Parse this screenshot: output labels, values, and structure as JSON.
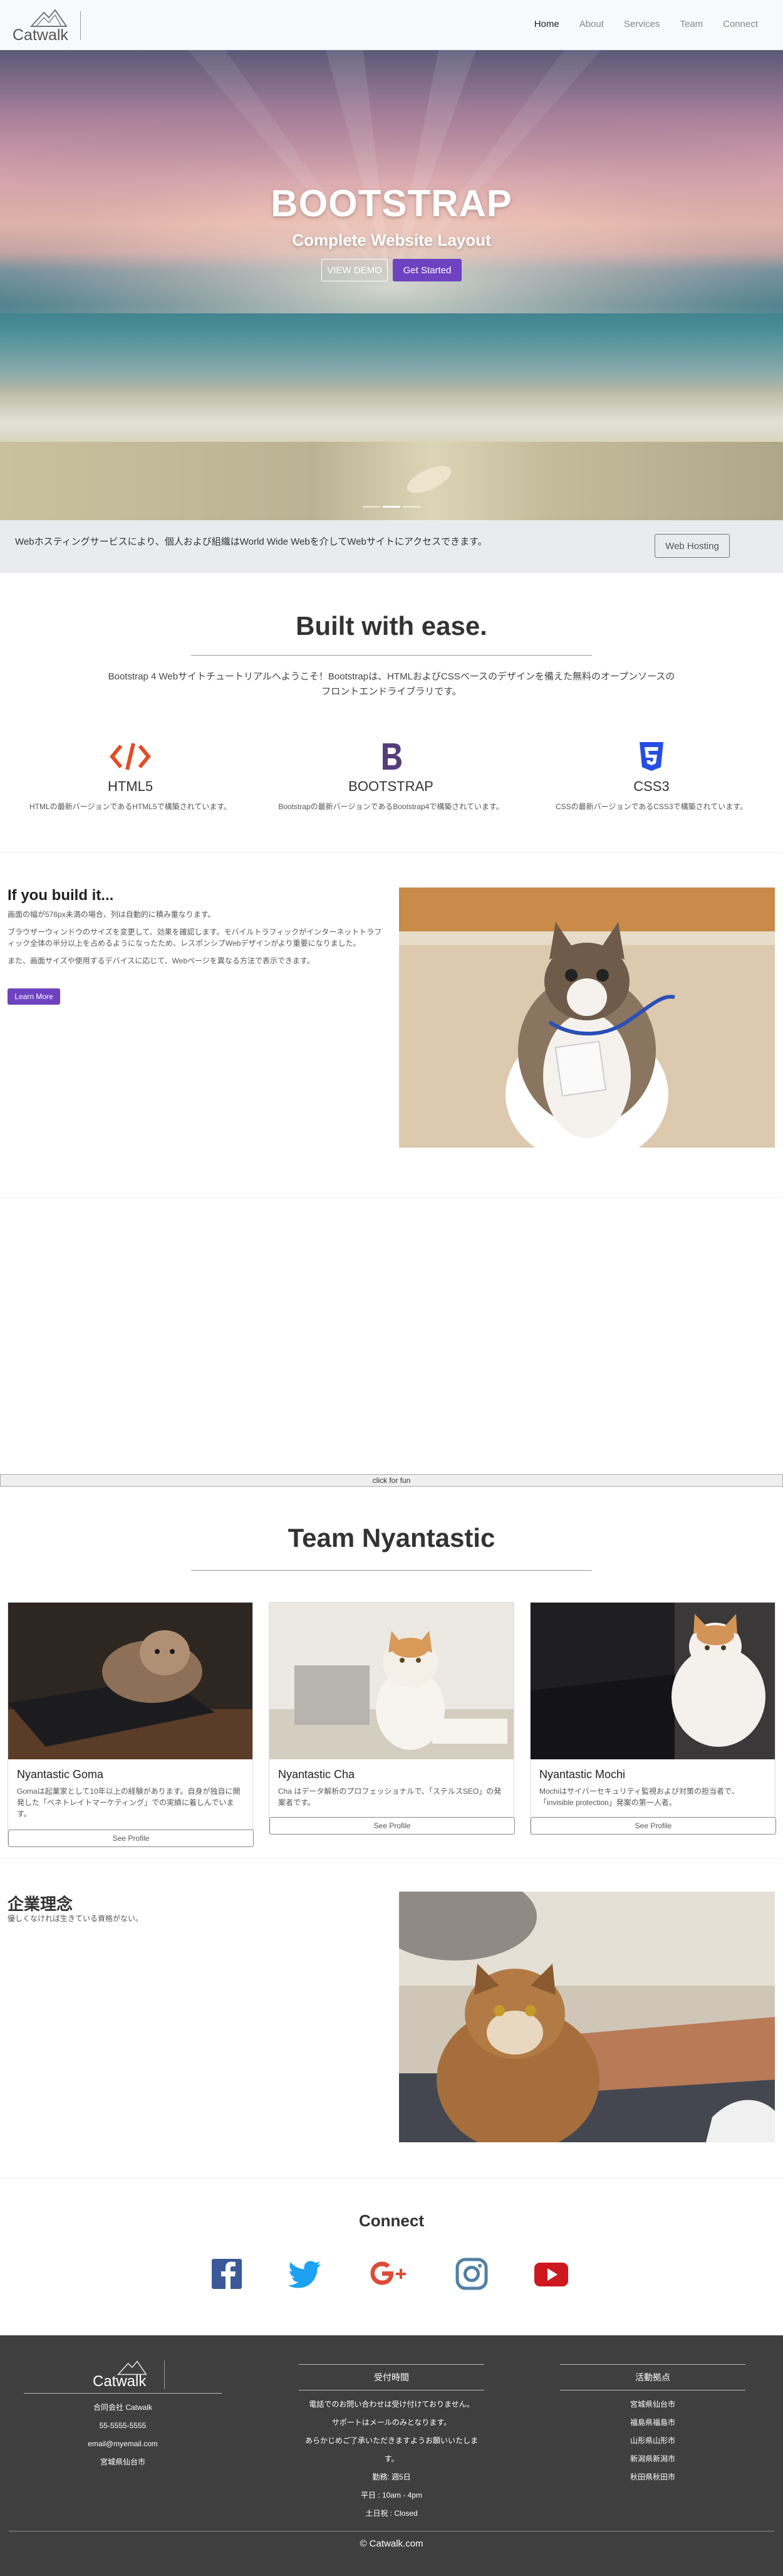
{
  "brand": {
    "name": "Catwalk"
  },
  "nav": {
    "items": [
      {
        "label": "Home",
        "active": true
      },
      {
        "label": "About"
      },
      {
        "label": "Services"
      },
      {
        "label": "Team"
      },
      {
        "label": "Connect"
      }
    ]
  },
  "hero": {
    "title": "BOOTSTRAP",
    "subtitle": "Complete Website Layout",
    "demo_label": "VIEW DEMO",
    "start_label": "Get Started",
    "slides": 3,
    "active_slide": 2
  },
  "jumbotron": {
    "text": "Webホスティングサービスにより、個人および組織はWorld Wide Webを介してWebサイトにアクセスできます。",
    "button_label": "Web Hosting"
  },
  "welcome": {
    "title": "Built with ease.",
    "intro": "Bootstrap 4 Webサイトチュートリアルへようこそ！Bootstrapは、HTMLおよびCSSベースのデザインを備えた無料のオープンソースのフロントエンドライブラリです。",
    "features": [
      {
        "name": "HTML5",
        "desc": "HTMLの最新バージョンであるHTML5で構築されています。",
        "icon": "code-icon",
        "color": "#e34c26"
      },
      {
        "name": "BOOTSTRAP",
        "desc": "Bootstrapの最新バージョンであるBootstrap4で構築されています。",
        "icon": "bootstrap-icon",
        "color": "#563d7c"
      },
      {
        "name": "CSS3",
        "desc": "CSSの最新バージョンであるCSS3で構築されています。",
        "icon": "css3-icon",
        "color": "#264de4"
      }
    ]
  },
  "build": {
    "title": "If you build it...",
    "p1": "画面の幅が576px未満の場合、列は自動的に積み重なります。",
    "p2": "ブラウザーウィンドウのサイズを変更して、効果を確認します。モバイルトラフィックがインターネットトラフィック全体の半分以上を占めるようになったため、レスポンシブWebデザインがより重要になりました。",
    "p3": "また、画面サイズや使用するデバイスに応じて、Webページを異なる方法で表示できます。",
    "button_label": "Learn More"
  },
  "fun": {
    "label": "click for fun"
  },
  "team": {
    "title": "Team Nyantastic",
    "members": [
      {
        "name": "Nyantastic Goma",
        "bio": "Gomaは起業家として10年以上の経験があります。自身が独自に開発した「ベネトレイトマーケティング」での実績に着しんでいます。",
        "button_label": "See Profile"
      },
      {
        "name": "Nyantastic Cha",
        "bio": "Cha はデータ解析のプロフェッショナルで、「ステルスSEO」の発案者です。",
        "button_label": "See Profile"
      },
      {
        "name": "Nyantastic Mochi",
        "bio": "Mochiはサイバーセキュリティ監視および対策の担当者で、「invisible protection」発案の第一人者。",
        "button_label": "See Profile"
      }
    ]
  },
  "philosophy": {
    "title": "企業理念",
    "text": "優しくなければ生きている資格がない。"
  },
  "connect": {
    "title": "Connect",
    "networks": [
      {
        "name": "facebook-icon",
        "color": "#3b5998"
      },
      {
        "name": "twitter-icon",
        "color": "#1da1f2"
      },
      {
        "name": "google-plus-icon",
        "color": "#dd4b39"
      },
      {
        "name": "instagram-icon",
        "color": "#517fa4"
      },
      {
        "name": "youtube-icon",
        "color": "#cc181e"
      }
    ]
  },
  "footer": {
    "contact": [
      "合同会社 Catwalk",
      "55-5555-5555",
      "email@myemail.com",
      "宮城県仙台市"
    ],
    "hours_title": "受付時間",
    "hours": [
      "電話でのお問い合わせは受け付けておりません。",
      "サポートはメールのみとなります。",
      "あらかじめご了承いただきますようお願いいたします。",
      "勤務: 週5日",
      "平日 : 10am - 4pm",
      "土日祝 : Closed"
    ],
    "locations_title": "活動拠点",
    "locations": [
      "宮城県仙台市",
      "福島県福島市",
      "山形県山形市",
      "新潟県新潟市",
      "秋田県秋田市"
    ],
    "copyright": "© Catwalk.com"
  }
}
